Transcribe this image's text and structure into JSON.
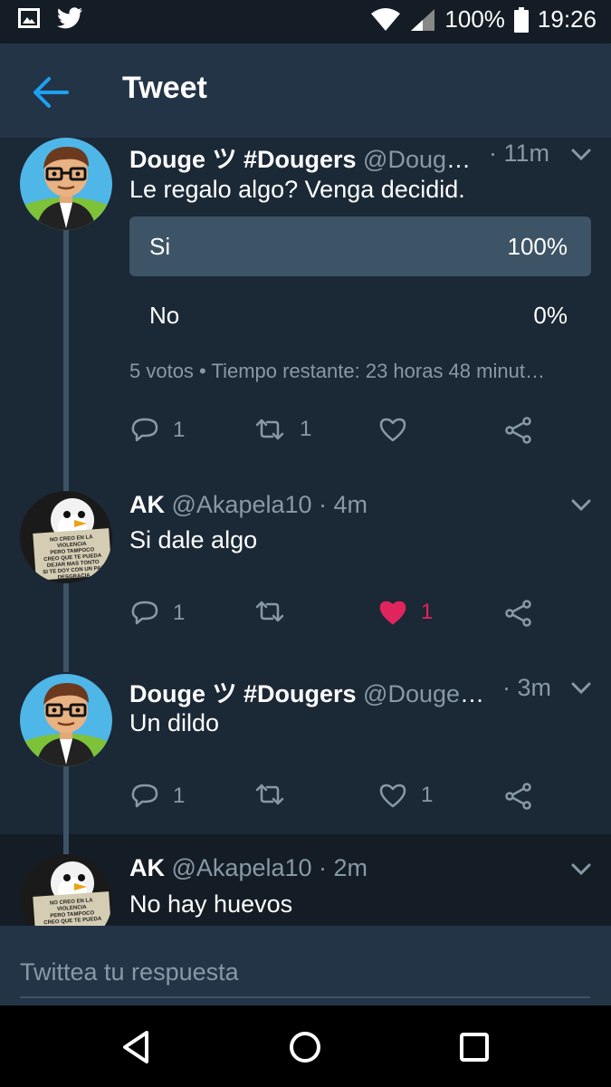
{
  "status_bar": {
    "battery": "100%",
    "time": "19:26"
  },
  "header": {
    "title": "Tweet"
  },
  "tweets": [
    {
      "name": "Douge ツ #Dougers",
      "handle": "@Douge…",
      "time": "· 11m",
      "text": "Le regalo algo? Venga decidid.",
      "poll": {
        "options": [
          {
            "label": "Si",
            "percent": "100%",
            "value": 100,
            "winner": true
          },
          {
            "label": "No",
            "percent": "0%",
            "value": 0,
            "winner": false
          }
        ],
        "meta": "5 votos • Tiempo restante: 23 horas 48 minut…"
      },
      "replies": "1",
      "retweets": "1",
      "likes": "",
      "liked": false
    },
    {
      "name": "AK",
      "handle": "@Akapela10",
      "time": "· 4m",
      "text": "Si dale algo",
      "replies": "1",
      "retweets": "",
      "likes": "1",
      "liked": true
    },
    {
      "name": "Douge ツ #Dougers",
      "handle": "@DougeP…",
      "time": "· 3m",
      "text": "Un dildo",
      "replies": "1",
      "retweets": "",
      "likes": "1",
      "liked": false
    },
    {
      "name": "AK",
      "handle": "@Akapela10",
      "time": "· 2m",
      "text": "No hay huevos"
    }
  ],
  "avatar_sign_text": "NO CREO EN LA VIOLENCIA PERO TAMPOCO CREO QUE TE PUEDA DEJAR MAS TONTO SI TE DOY CON UN PAL DESGRACIA",
  "reply": {
    "placeholder": "Twittea tu respuesta"
  },
  "colors": {
    "background": "#1b2836",
    "header": "#243447",
    "accent": "#1da1f2",
    "like": "#e0245e",
    "secondary_text": "#8899a6",
    "poll_winner": "#3d5466"
  }
}
